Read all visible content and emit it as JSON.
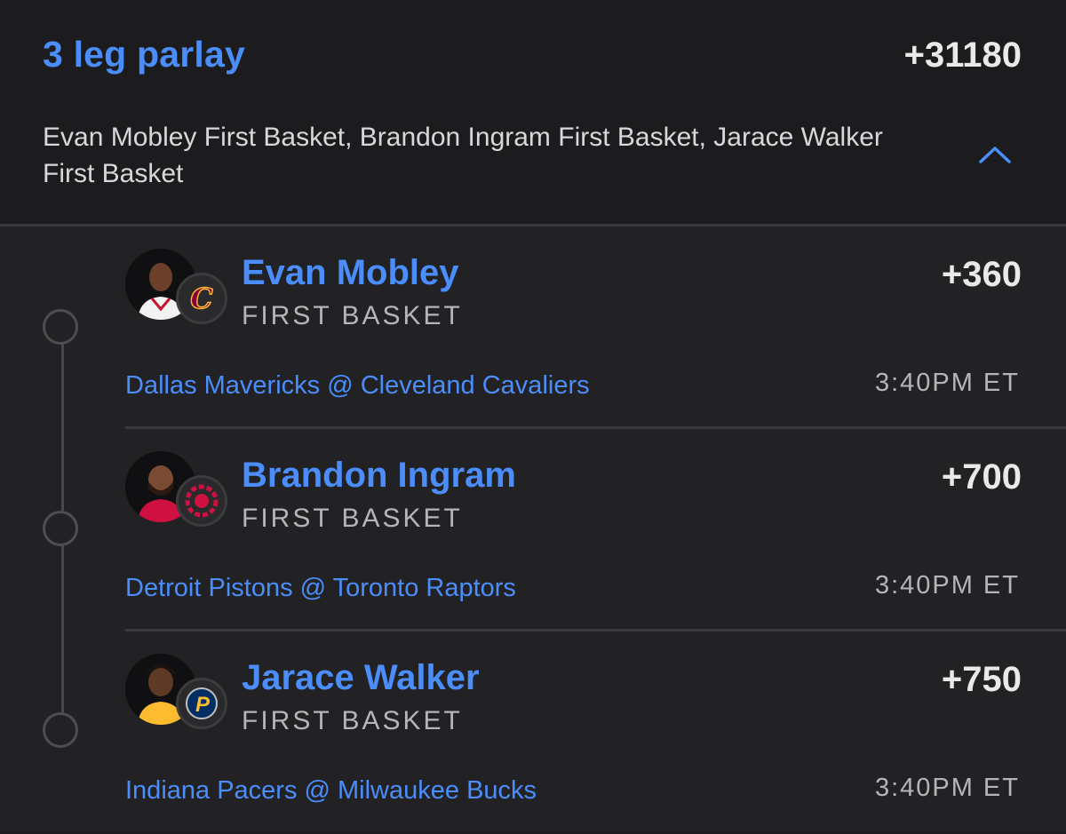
{
  "parlay": {
    "title": "3 leg parlay",
    "odds": "+31180",
    "summary": "Evan Mobley First Basket, Brandon Ingram First Basket, Jarace Walker First Basket",
    "collapse_icon": "chevron-up-icon"
  },
  "legs": [
    {
      "player": "Evan Mobley",
      "market": "FIRST BASKET",
      "odds": "+360",
      "matchup": "Dallas Mavericks @ Cleveland Cavaliers",
      "time": "3:40PM ET",
      "team_color": "#860038",
      "team_accent": "#fdbb30"
    },
    {
      "player": "Brandon Ingram",
      "market": "FIRST BASKET",
      "odds": "+700",
      "matchup": "Detroit Pistons @ Toronto Raptors",
      "time": "3:40PM ET",
      "team_color": "#ce1141",
      "team_accent": "#000000"
    },
    {
      "player": "Jarace Walker",
      "market": "FIRST BASKET",
      "odds": "+750",
      "matchup": "Indiana Pacers @ Milwaukee Bucks",
      "time": "3:40PM ET",
      "team_color": "#002d62",
      "team_accent": "#fdbb30"
    }
  ],
  "colors": {
    "accent": "#4a8dfb",
    "background": "#1c1c1e"
  }
}
